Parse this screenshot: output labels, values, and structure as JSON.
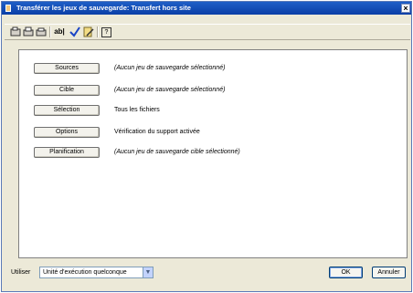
{
  "window": {
    "title": "Transférer les jeux de sauvegarde: Transfert hors site",
    "close": "×"
  },
  "toolbar": {
    "text_icon": "ab|",
    "help_icon": "?"
  },
  "rows": [
    {
      "button": "Sources",
      "value": "(Aucun jeu de sauvegarde sélectionné)"
    },
    {
      "button": "Cible",
      "value": "(Aucun jeu de sauvegarde sélectionné)"
    },
    {
      "button": "Sélection",
      "value": "Tous les fichiers"
    },
    {
      "button": "Options",
      "value": "Vérification du support activée"
    },
    {
      "button": "Planification",
      "value": "(Aucun jeu de sauvegarde cible sélectionné)"
    }
  ],
  "footer": {
    "use_label": "Utiliser",
    "execution_select": "Unité d'exécution quelconque",
    "ok_label": "OK",
    "cancel_label": "Annuler"
  },
  "colors": {
    "titlebar": "#0a3ea6",
    "dialog_bg": "#ece9d8",
    "panel_bg": "#ffffff"
  }
}
